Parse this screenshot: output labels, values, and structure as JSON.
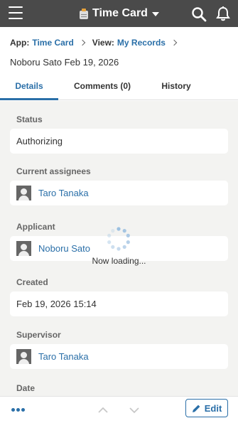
{
  "header": {
    "app_title": "Time Card",
    "menu_icon": "hamburger-menu-icon",
    "search_icon": "search-icon",
    "notification_icon": "bell-icon"
  },
  "breadcrumb": {
    "app_label": "App:",
    "app_value": "Time Card",
    "view_label": "View:",
    "view_value": "My Records"
  },
  "record": {
    "title": "Noboru Sato Feb 19, 2026"
  },
  "tabs": [
    {
      "label": "Details",
      "active": true
    },
    {
      "label": "Comments (0)",
      "active": false
    },
    {
      "label": "History",
      "active": false
    }
  ],
  "fields": {
    "status": {
      "label": "Status",
      "value": "Authorizing"
    },
    "assignees": {
      "label": "Current assignees",
      "value": "Taro Tanaka"
    },
    "applicant": {
      "label": "Applicant",
      "value": "Noboru Sato"
    },
    "created": {
      "label": "Created",
      "value": "Feb 19, 2026 15:14"
    },
    "supervisor": {
      "label": "Supervisor",
      "value": "Taro Tanaka"
    },
    "date": {
      "label": "Date"
    }
  },
  "loading": {
    "text": "Now loading..."
  },
  "footer": {
    "more_icon": "more-options-icon",
    "prev_icon": "chevron-up-icon",
    "next_icon": "chevron-down-icon",
    "edit_label": "Edit",
    "edit_icon": "pencil-icon"
  },
  "colors": {
    "accent": "#2a6fa8",
    "header_bg": "#4a4a4a",
    "content_bg": "#f3f3f1"
  }
}
